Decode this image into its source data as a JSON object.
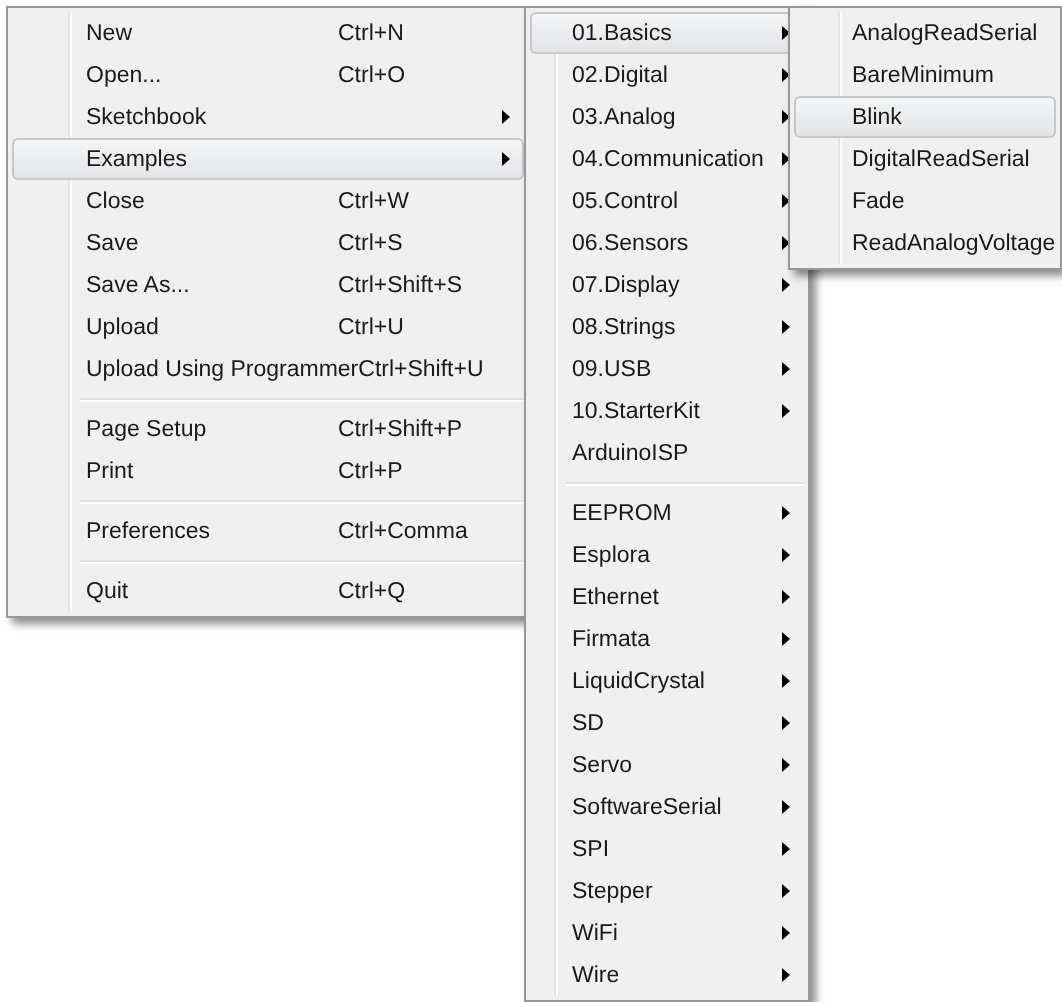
{
  "menus": [
    {
      "items": [
        {
          "kind": "item",
          "label": "New",
          "shortcut": "Ctrl+N",
          "has_submenu": false,
          "selected": false
        },
        {
          "kind": "item",
          "label": "Open...",
          "shortcut": "Ctrl+O",
          "has_submenu": false,
          "selected": false
        },
        {
          "kind": "item",
          "label": "Sketchbook",
          "has_submenu": true,
          "selected": false
        },
        {
          "kind": "item",
          "label": "Examples",
          "has_submenu": true,
          "selected": true
        },
        {
          "kind": "item",
          "label": "Close",
          "shortcut": "Ctrl+W",
          "has_submenu": false,
          "selected": false
        },
        {
          "kind": "item",
          "label": "Save",
          "shortcut": "Ctrl+S",
          "has_submenu": false,
          "selected": false
        },
        {
          "kind": "item",
          "label": "Save As...",
          "shortcut": "Ctrl+Shift+S",
          "has_submenu": false,
          "selected": false
        },
        {
          "kind": "item",
          "label": "Upload",
          "shortcut": "Ctrl+U",
          "has_submenu": false,
          "selected": false
        },
        {
          "kind": "item",
          "label": "Upload Using Programmer",
          "shortcut": "Ctrl+Shift+U",
          "has_submenu": false,
          "selected": false
        },
        {
          "kind": "separator"
        },
        {
          "kind": "item",
          "label": "Page Setup",
          "shortcut": "Ctrl+Shift+P",
          "has_submenu": false,
          "selected": false
        },
        {
          "kind": "item",
          "label": "Print",
          "shortcut": "Ctrl+P",
          "has_submenu": false,
          "selected": false
        },
        {
          "kind": "separator"
        },
        {
          "kind": "item",
          "label": "Preferences",
          "shortcut": "Ctrl+Comma",
          "has_submenu": false,
          "selected": false
        },
        {
          "kind": "separator"
        },
        {
          "kind": "item",
          "label": "Quit",
          "shortcut": "Ctrl+Q",
          "has_submenu": false,
          "selected": false
        }
      ]
    },
    {
      "items": [
        {
          "kind": "item",
          "label": "01.Basics",
          "has_submenu": true,
          "selected": true
        },
        {
          "kind": "item",
          "label": "02.Digital",
          "has_submenu": true,
          "selected": false
        },
        {
          "kind": "item",
          "label": "03.Analog",
          "has_submenu": true,
          "selected": false
        },
        {
          "kind": "item",
          "label": "04.Communication",
          "has_submenu": true,
          "selected": false
        },
        {
          "kind": "item",
          "label": "05.Control",
          "has_submenu": true,
          "selected": false
        },
        {
          "kind": "item",
          "label": "06.Sensors",
          "has_submenu": true,
          "selected": false
        },
        {
          "kind": "item",
          "label": "07.Display",
          "has_submenu": true,
          "selected": false
        },
        {
          "kind": "item",
          "label": "08.Strings",
          "has_submenu": true,
          "selected": false
        },
        {
          "kind": "item",
          "label": "09.USB",
          "has_submenu": true,
          "selected": false
        },
        {
          "kind": "item",
          "label": "10.StarterKit",
          "has_submenu": true,
          "selected": false
        },
        {
          "kind": "item",
          "label": "ArduinoISP",
          "has_submenu": false,
          "selected": false
        },
        {
          "kind": "separator"
        },
        {
          "kind": "item",
          "label": "EEPROM",
          "has_submenu": true,
          "selected": false
        },
        {
          "kind": "item",
          "label": "Esplora",
          "has_submenu": true,
          "selected": false
        },
        {
          "kind": "item",
          "label": "Ethernet",
          "has_submenu": true,
          "selected": false
        },
        {
          "kind": "item",
          "label": "Firmata",
          "has_submenu": true,
          "selected": false
        },
        {
          "kind": "item",
          "label": "LiquidCrystal",
          "has_submenu": true,
          "selected": false
        },
        {
          "kind": "item",
          "label": "SD",
          "has_submenu": true,
          "selected": false
        },
        {
          "kind": "item",
          "label": "Servo",
          "has_submenu": true,
          "selected": false
        },
        {
          "kind": "item",
          "label": "SoftwareSerial",
          "has_submenu": true,
          "selected": false
        },
        {
          "kind": "item",
          "label": "SPI",
          "has_submenu": true,
          "selected": false
        },
        {
          "kind": "item",
          "label": "Stepper",
          "has_submenu": true,
          "selected": false
        },
        {
          "kind": "item",
          "label": "WiFi",
          "has_submenu": true,
          "selected": false
        },
        {
          "kind": "item",
          "label": "Wire",
          "has_submenu": true,
          "selected": false
        }
      ]
    },
    {
      "items": [
        {
          "kind": "item",
          "label": "AnalogReadSerial",
          "has_submenu": false,
          "selected": false
        },
        {
          "kind": "item",
          "label": "BareMinimum",
          "has_submenu": false,
          "selected": false
        },
        {
          "kind": "item",
          "label": "Blink",
          "has_submenu": false,
          "selected": true
        },
        {
          "kind": "item",
          "label": "DigitalReadSerial",
          "has_submenu": false,
          "selected": false
        },
        {
          "kind": "item",
          "label": "Fade",
          "has_submenu": false,
          "selected": false
        },
        {
          "kind": "item",
          "label": "ReadAnalogVoltage",
          "has_submenu": false,
          "selected": false
        }
      ]
    }
  ]
}
